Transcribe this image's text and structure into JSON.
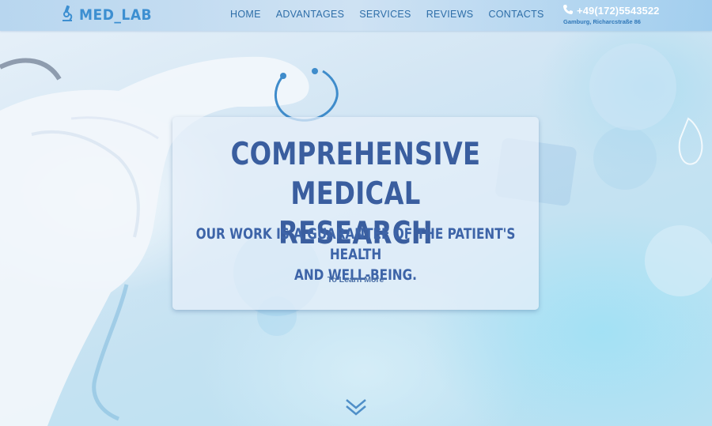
{
  "brand": {
    "name": "MED_LAB",
    "logo_icon": "microscope-icon"
  },
  "nav": {
    "items": [
      {
        "label": "HOME"
      },
      {
        "label": "ADVANTAGES"
      },
      {
        "label": "SERVICES"
      },
      {
        "label": "REVIEWS"
      },
      {
        "label": "CONTACTS"
      }
    ]
  },
  "contact": {
    "phone_icon": "phone-icon",
    "phone": "+49(172)5543522",
    "address": "Gamburg, Richarcstraße 86"
  },
  "hero": {
    "title_line1": "COMPREHENSIVE MEDICAL",
    "title_line2": "RESEARCH",
    "subtitle_line1": "OUR WORK IS A GUARANTEE OF THE PATIENT'S HEALTH",
    "subtitle_line2": "AND WELL-BEING.",
    "cta_label": "To Learn More"
  },
  "scroll_icon": "double-chevron-down-icon",
  "colors": {
    "accent": "#3d8fd1",
    "title": "#3a5e9f",
    "nav": "#2e6ea8"
  }
}
